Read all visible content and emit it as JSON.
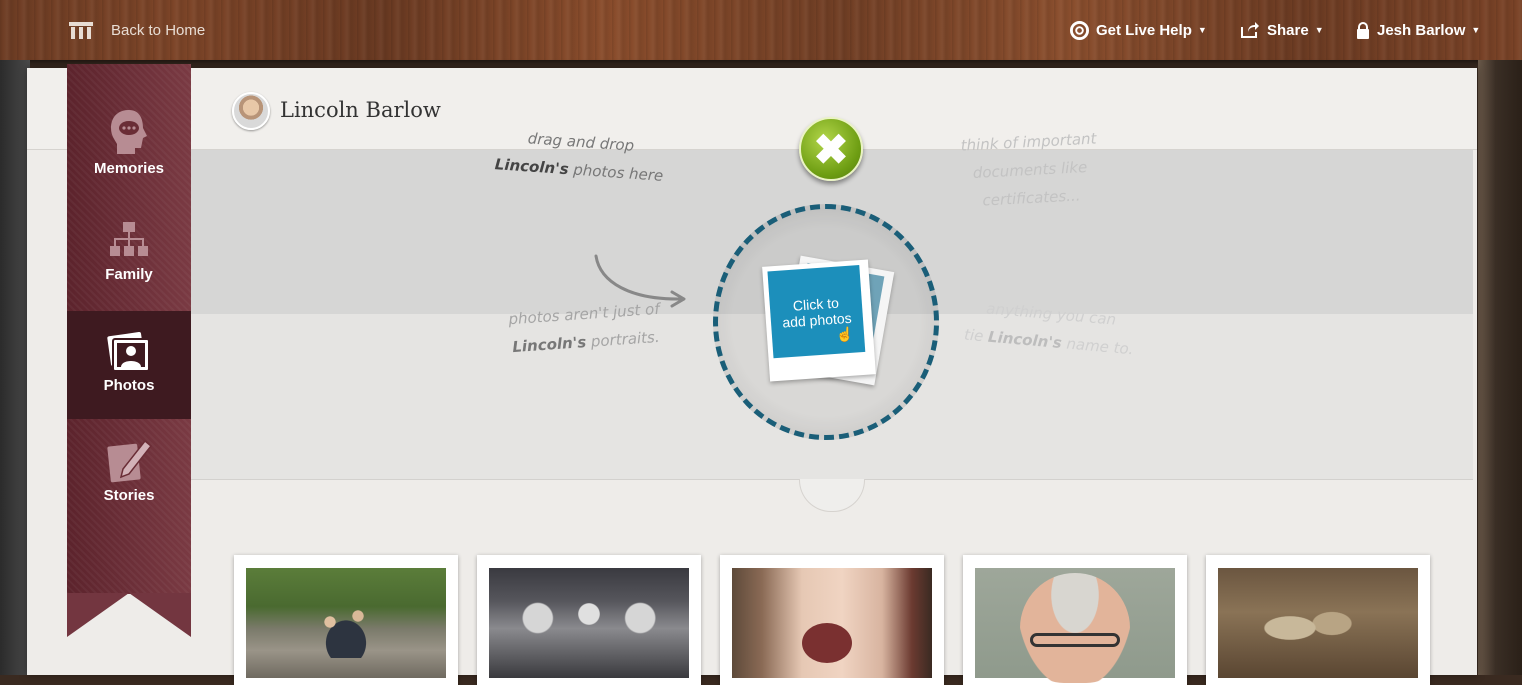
{
  "topbar": {
    "home_label": "Back to Home",
    "help_label": "Get Live Help",
    "share_label": "Share",
    "user_label": "Jesh Barlow"
  },
  "profile": {
    "name": "Lincoln Barlow"
  },
  "sidebar": {
    "items": [
      {
        "label": "Memories",
        "icon": "head-chat-icon"
      },
      {
        "label": "Family",
        "icon": "family-tree-icon"
      },
      {
        "label": "Photos",
        "icon": "photos-icon",
        "active": true
      },
      {
        "label": "Stories",
        "icon": "pen-paper-icon"
      }
    ]
  },
  "upload": {
    "drag_line1": "drag and drop",
    "drag_name": "Lincoln's",
    "drag_line2": "photos here",
    "docs_line1": "think of important",
    "docs_line2": "documents like",
    "docs_line3": "certificates...",
    "portraits_line1": "photos aren't just of",
    "portraits_name": "Lincoln's",
    "portraits_line2": "portraits.",
    "anything_line1": "anything you can",
    "anything_pre": "tie",
    "anything_name": "Lincoln's",
    "anything_post": "name to.",
    "add_photos_label": "Click to add photos"
  },
  "photos": [
    {
      "desc": "family-outdoor-photo"
    },
    {
      "desc": "three-men-photo"
    },
    {
      "desc": "baby-photo"
    },
    {
      "desc": "older-man-portrait"
    },
    {
      "desc": "sepia-outdoor-photo"
    }
  ],
  "colors": {
    "ribbon": "#6a2d36",
    "accent_blue": "#1c8fbb",
    "close_green": "#6e9e13"
  }
}
